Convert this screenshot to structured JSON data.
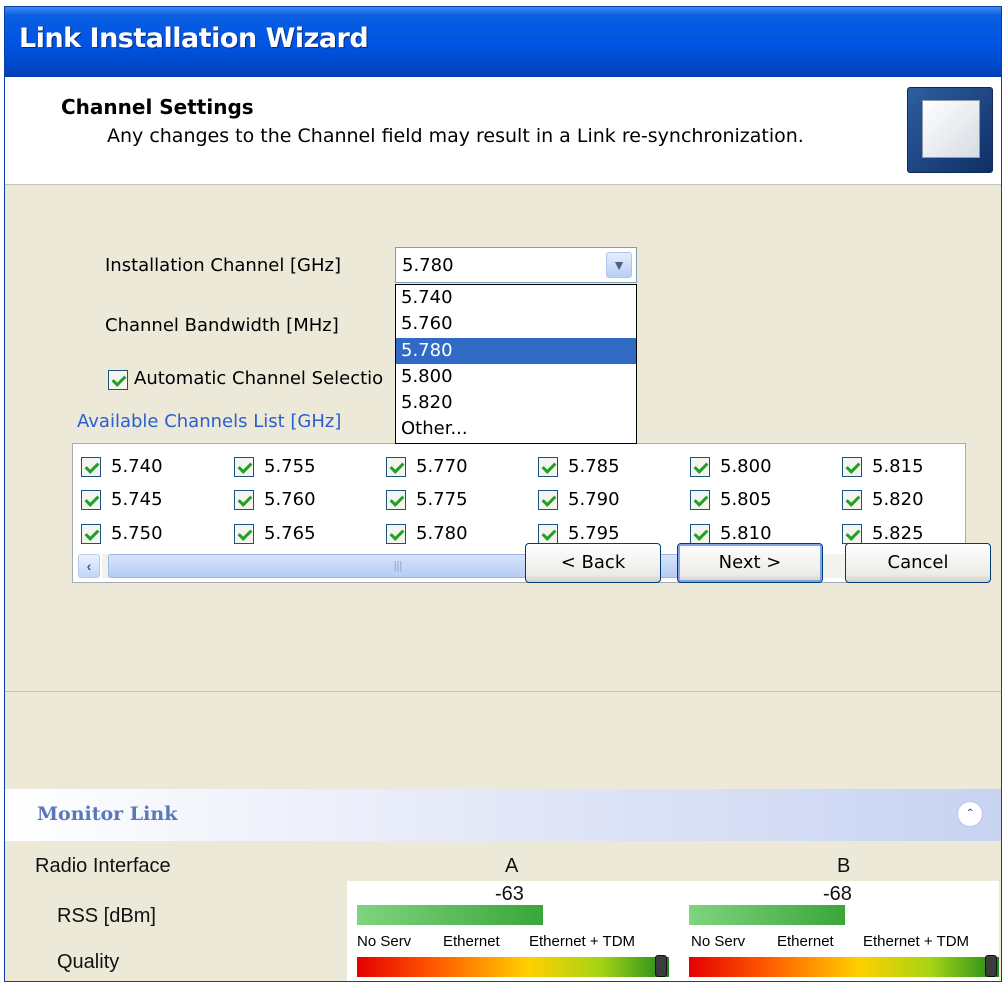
{
  "window": {
    "title": "Link Installation Wizard"
  },
  "header": {
    "title": "Channel Settings",
    "subtitle": "Any changes to the Channel field may result in a Link re-synchronization."
  },
  "settings": {
    "installation_channel_label": "Installation Channel [GHz]",
    "installation_channel_value": "5.780",
    "bandwidth_label": "Channel Bandwidth [MHz]",
    "auto_selection_label": "Automatic Channel Selectio",
    "auto_selection_checked": true,
    "dropdown_options": [
      "5.740",
      "5.760",
      "5.780",
      "5.800",
      "5.820",
      "Other..."
    ],
    "dropdown_selected": "5.780"
  },
  "available": {
    "title": "Available Channels List [GHz]",
    "columns": [
      [
        "5.740",
        "5.745",
        "5.750"
      ],
      [
        "5.755",
        "5.760",
        "5.765"
      ],
      [
        "5.770",
        "5.775",
        "5.780"
      ],
      [
        "5.785",
        "5.790",
        "5.795"
      ],
      [
        "5.800",
        "5.805",
        "5.810"
      ],
      [
        "5.815",
        "5.820",
        "5.825"
      ]
    ]
  },
  "buttons": {
    "back": "< Back",
    "next": "Next >",
    "cancel": "Cancel"
  },
  "monitor": {
    "title": "Monitor Link",
    "radio_interface_label": "Radio Interface",
    "site_a": "A",
    "site_b": "B",
    "rss_label": "RSS [dBm]",
    "rss_a": "-63",
    "rss_b": "-68",
    "quality_label": "Quality",
    "quality_scale": [
      "No Serv",
      "Ethernet",
      "Ethernet + TDM"
    ],
    "quality_scale_b": [
      "No Serv",
      "Ethernet",
      "Ethernet + TDM"
    ]
  },
  "icons": {
    "collapse": "double-chevron-up-icon",
    "dropdown": "chevron-down-icon"
  }
}
